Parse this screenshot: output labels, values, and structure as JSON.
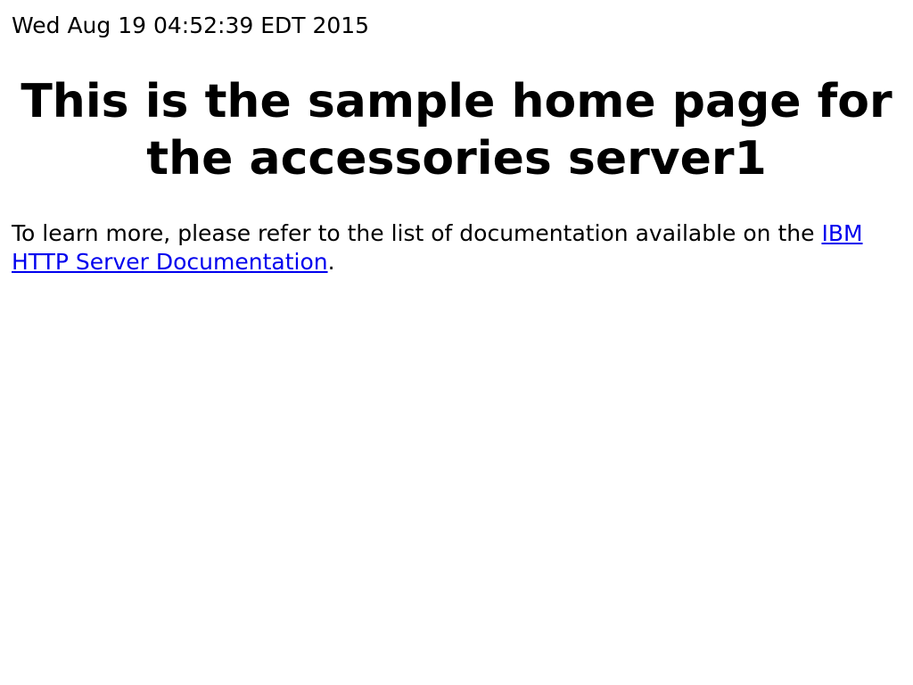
{
  "timestamp": "Wed Aug 19 04:52:39 EDT 2015",
  "headline": "This is the sample home page for the accessories server1",
  "intro": {
    "text_before_link": "To learn more, please refer to the list of documentation available on the ",
    "link_text": "IBM HTTP Server Documentation",
    "text_after_link": "."
  },
  "colors": {
    "background": "#ffffff",
    "text": "#000000",
    "link": "#0000ee"
  }
}
